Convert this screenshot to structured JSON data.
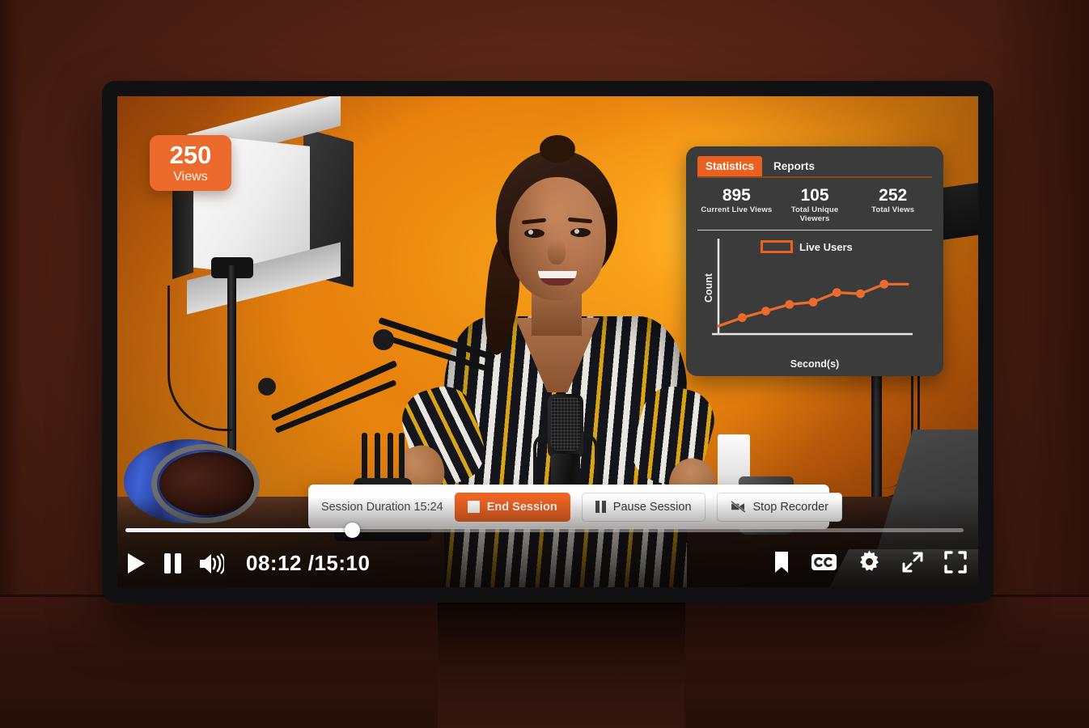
{
  "theme": {
    "accent_orange": "#ec6a2c",
    "button_orange": "#ef6423",
    "panel_dark": "#3b3b3b",
    "bg_maroon": "#4a1e14",
    "screen_orange": "#e8820d"
  },
  "views_badge": {
    "count": "250",
    "label": "Views"
  },
  "stats_panel": {
    "tabs": [
      {
        "label": "Statistics",
        "active": true
      },
      {
        "label": "Reports",
        "active": false
      }
    ],
    "metrics": [
      {
        "value": "895",
        "label": "Current Live Views"
      },
      {
        "value": "105",
        "label": "Total Unique Viewers"
      },
      {
        "value": "252",
        "label": "Total Views"
      }
    ]
  },
  "chart_data": {
    "type": "line",
    "title": "",
    "xlabel": "Second(s)",
    "ylabel": "Count",
    "legend": [
      "Live Users"
    ],
    "legend_position": "top-center",
    "grid": false,
    "series": [
      {
        "name": "Live Users",
        "color": "#ec6a2c",
        "x": [
          0,
          1,
          2,
          3,
          4,
          5,
          6,
          7,
          8
        ],
        "values": [
          8,
          22,
          33,
          44,
          48,
          64,
          62,
          78,
          78
        ]
      }
    ],
    "xlim": [
      0,
      8
    ],
    "ylim": [
      0,
      100
    ],
    "marker_count": 8
  },
  "session_bar": {
    "duration_text": "Session Duration 15:24",
    "buttons": [
      {
        "label": "End Session",
        "icon": "stop-square-icon",
        "style": "primary"
      },
      {
        "label": "Pause Session",
        "icon": "pause-icon",
        "style": "secondary"
      },
      {
        "label": "Stop Recorder",
        "icon": "camera-off-icon",
        "style": "secondary"
      }
    ]
  },
  "player": {
    "current_time": "08:12",
    "total_time": "15:10",
    "time_display": "08:12 /15:10",
    "progress_percent": 27,
    "left_controls": [
      "play-icon",
      "pause-icon",
      "volume-icon"
    ],
    "right_controls": [
      "bookmark-icon",
      "closed-caption-icon",
      "gear-icon",
      "expand-arrows-icon",
      "fullscreen-icon"
    ]
  }
}
